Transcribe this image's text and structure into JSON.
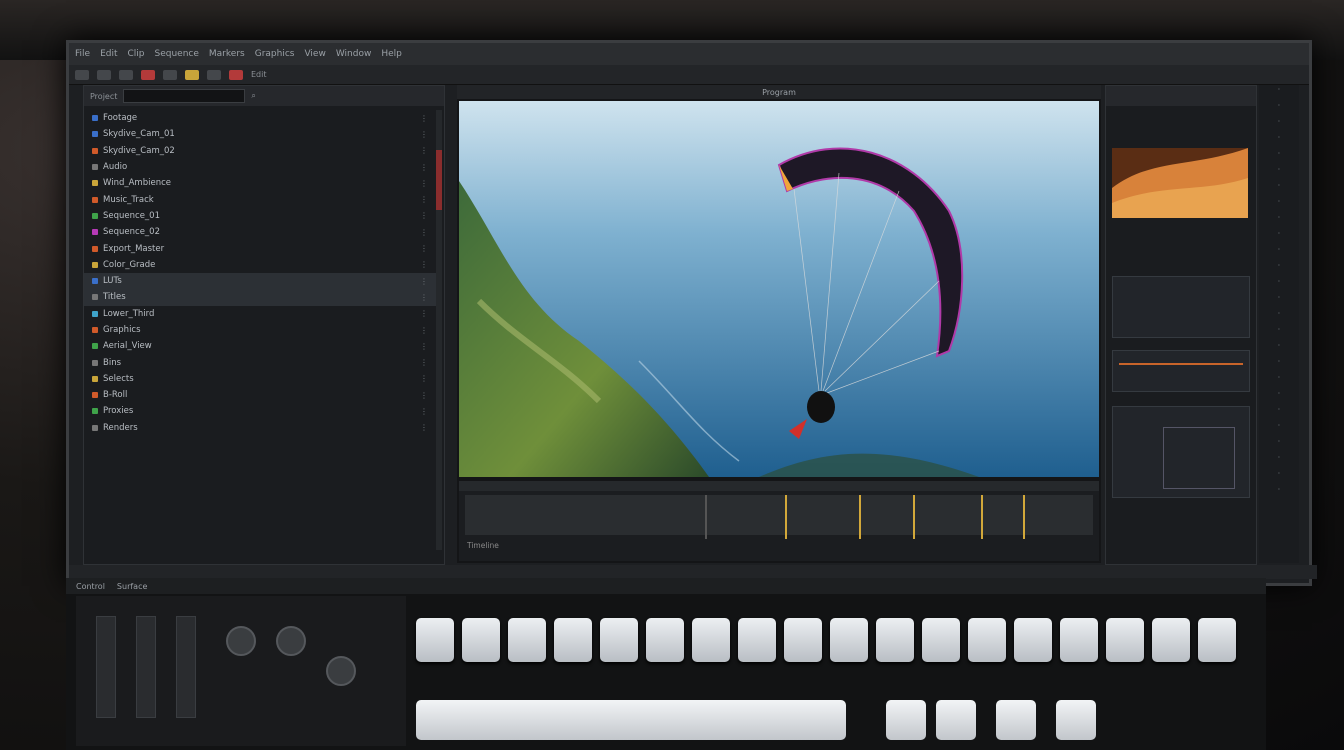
{
  "app": {
    "menu": [
      "File",
      "Edit",
      "Clip",
      "Sequence",
      "Markers",
      "Graphics",
      "View",
      "Window",
      "Help"
    ],
    "toolbar_label": "Edit"
  },
  "project_panel": {
    "header": "Project",
    "items": [
      {
        "label": "Footage",
        "color": "#3a6fc9",
        "end": ""
      },
      {
        "label": "Skydive_Cam_01",
        "color": "#3a6fc9",
        "end": ""
      },
      {
        "label": "Skydive_Cam_02",
        "color": "#d05a2a",
        "end": ""
      },
      {
        "label": "Audio",
        "color": "#777777",
        "end": ""
      },
      {
        "label": "Wind_Ambience",
        "color": "#c9a53a",
        "end": ""
      },
      {
        "label": "Music_Track",
        "color": "#d05a2a",
        "end": ""
      },
      {
        "label": "Sequence_01",
        "color": "#3fa34a",
        "end": ""
      },
      {
        "label": "Sequence_02",
        "color": "#b73ab7",
        "end": ""
      },
      {
        "label": "Export_Master",
        "color": "#d05a2a",
        "end": ""
      },
      {
        "label": "Color_Grade",
        "color": "#c9a53a",
        "end": ""
      },
      {
        "label": "LUTs",
        "color": "#3a6fc9",
        "end": ""
      },
      {
        "label": "Titles",
        "color": "#777777",
        "end": ""
      },
      {
        "label": "Lower_Third",
        "color": "#3fa3c9",
        "end": ""
      },
      {
        "label": "Graphics",
        "color": "#d05a2a",
        "end": ""
      },
      {
        "label": "Aerial_View",
        "color": "#3fa34a",
        "end": ""
      },
      {
        "label": "Bins",
        "color": "#777777",
        "end": ""
      },
      {
        "label": "Selects",
        "color": "#c9a53a",
        "end": ""
      },
      {
        "label": "B-Roll",
        "color": "#d05a2a",
        "end": ""
      },
      {
        "label": "Proxies",
        "color": "#3fa34a",
        "end": ""
      },
      {
        "label": "Renders",
        "color": "#777777",
        "end": ""
      }
    ]
  },
  "viewer": {
    "header": "Program"
  },
  "timeline": {
    "label": "Timeline"
  },
  "console": {
    "header": [
      "Control",
      "Surface"
    ]
  },
  "keys": [
    "",
    "",
    "",
    "",
    "",
    "",
    "",
    "",
    "",
    "",
    "",
    "",
    "",
    "",
    "",
    "",
    "",
    ""
  ]
}
